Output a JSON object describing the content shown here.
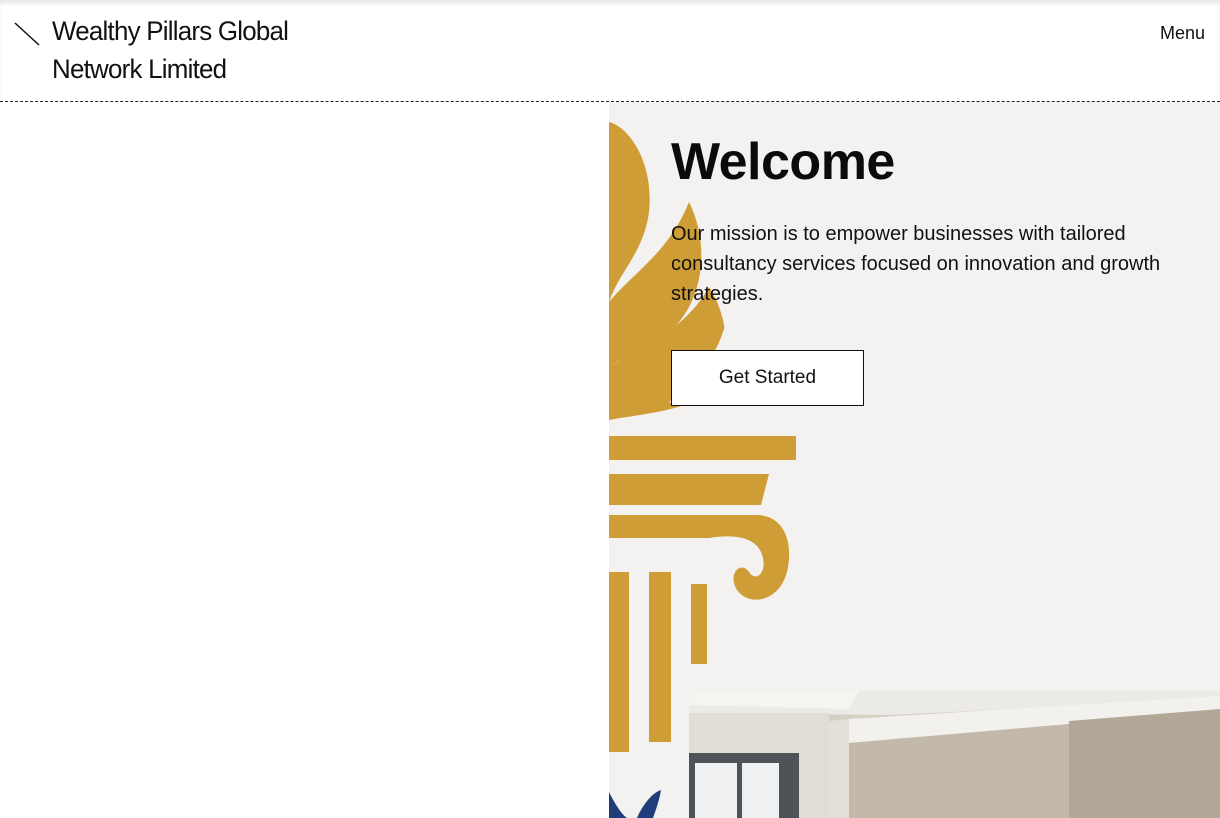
{
  "header": {
    "brand_line1": "Wealthy Pillars Global",
    "brand_line2": "Network Limited",
    "menu_label": "Menu",
    "logo_icon": "diagonal-slash-icon"
  },
  "hero": {
    "title": "Welcome",
    "mission": "Our mission is to empower businesses with tailored consultancy services focused on innovation and growth strategies.",
    "cta_label": "Get Started",
    "background_image": "gold-pillar-torch-logo",
    "office_image": "office-interior-photo"
  },
  "colors": {
    "hero_bg": "#f3f2f0",
    "gold": "#cf9d35",
    "navy": "#1f3d7a",
    "text": "#111111"
  }
}
